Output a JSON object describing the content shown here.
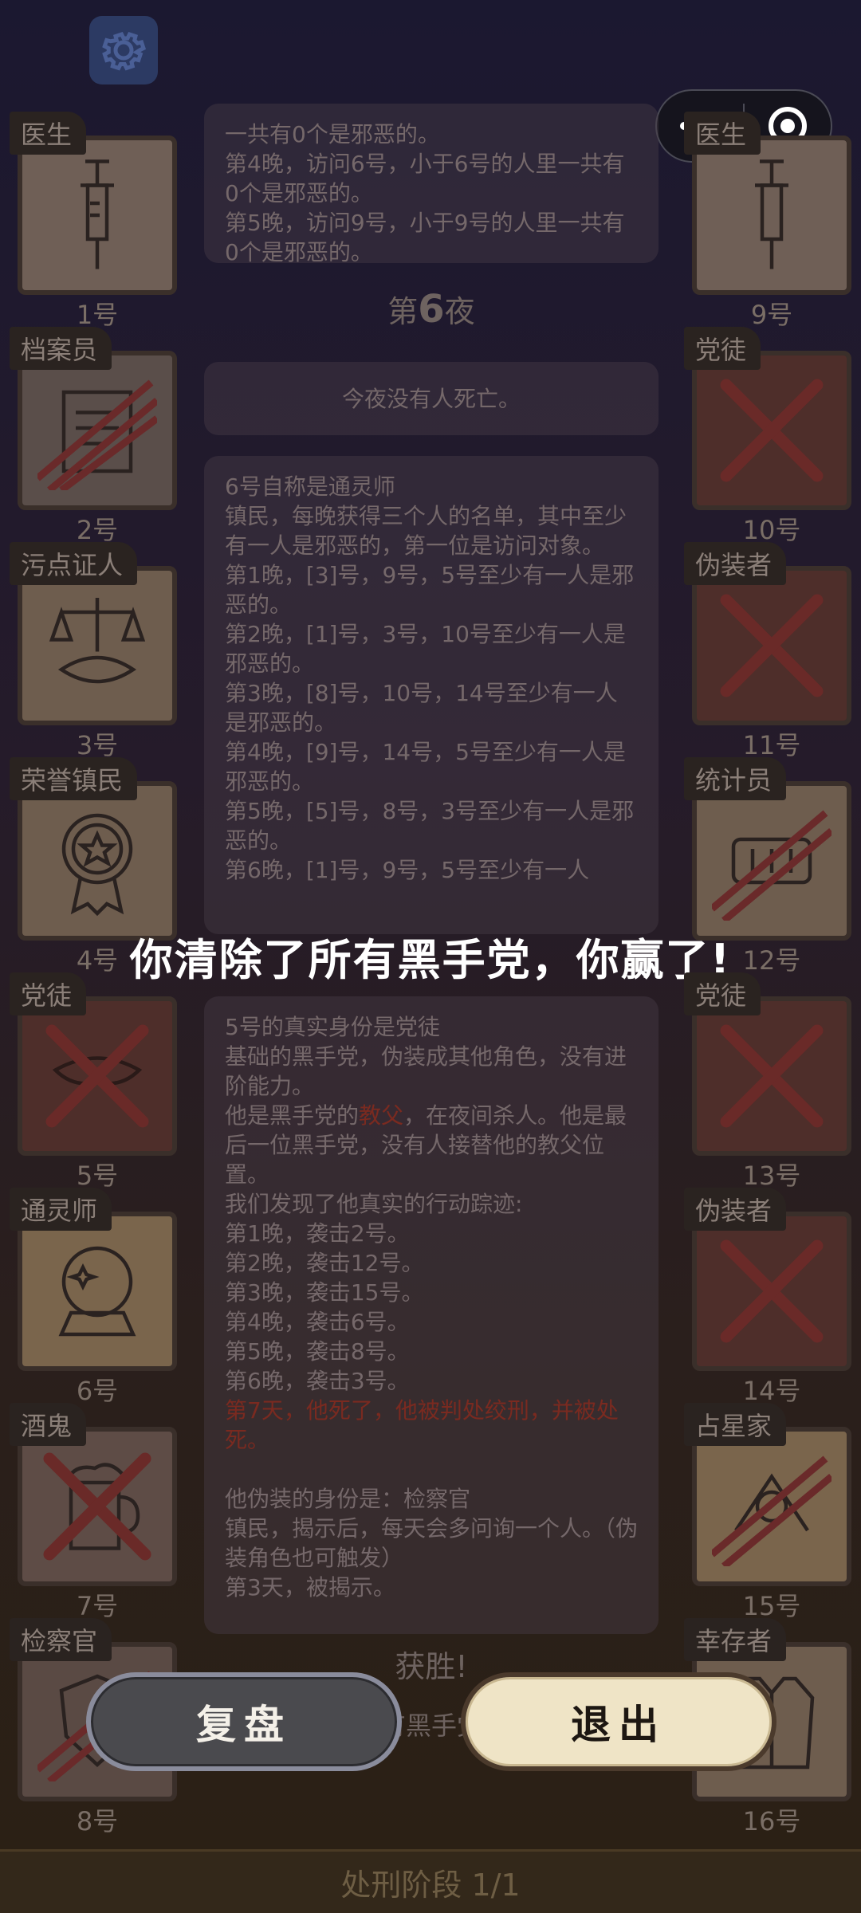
{
  "capsule": {
    "more_icon": "more-dots-icon",
    "close_icon": "target-close-icon"
  },
  "left_cards": [
    {
      "role": "医生",
      "num": "1号",
      "icon": "syringe-icon",
      "status": "alive"
    },
    {
      "role": "档案员",
      "num": "2号",
      "icon": "document-icon",
      "status": "slashed"
    },
    {
      "role": "污点证人",
      "num": "3号",
      "icon": "scales-icon",
      "status": "alive"
    },
    {
      "role": "荣誉镇民",
      "num": "4号",
      "icon": "medal-icon",
      "status": "alive"
    },
    {
      "role": "党徒",
      "num": "5号",
      "icon": "mask-icon",
      "status": "crossed"
    },
    {
      "role": "通灵师",
      "num": "6号",
      "icon": "crystal-ball-icon",
      "status": "alive"
    },
    {
      "role": "酒鬼",
      "num": "7号",
      "icon": "beer-icon",
      "status": "crossed"
    },
    {
      "role": "检察官",
      "num": "8号",
      "icon": "badge-icon",
      "status": "slashed"
    }
  ],
  "right_cards": [
    {
      "role": "医生",
      "num": "9号",
      "icon": "syringe-icon",
      "status": "alive"
    },
    {
      "role": "党徒",
      "num": "10号",
      "icon": "mask-icon",
      "status": "crossed"
    },
    {
      "role": "伪装者",
      "num": "11号",
      "icon": "mask-icon",
      "status": "crossed"
    },
    {
      "role": "统计员",
      "num": "12号",
      "icon": "counter-icon",
      "status": "slashed"
    },
    {
      "role": "党徒",
      "num": "13号",
      "icon": "mask-icon",
      "status": "crossed"
    },
    {
      "role": "伪装者",
      "num": "14号",
      "icon": "mask-icon",
      "status": "crossed"
    },
    {
      "role": "占星家",
      "num": "15号",
      "icon": "astrolabe-icon",
      "status": "slashed"
    },
    {
      "role": "幸存者",
      "num": "16号",
      "icon": "vest-icon",
      "status": "alive"
    }
  ],
  "log": {
    "top_panel": [
      "一共有0个是邪恶的。",
      "第4晚，访问6号，小于6号的人里一共有0个是邪恶的。",
      "第5晚，访问9号，小于9号的人里一共有0个是邪恶的。"
    ],
    "night_title_prefix": "第",
    "night_title_num": "6",
    "night_title_suffix": "夜",
    "no_death": "今夜没有人死亡。",
    "medium_panel": [
      "6号自称是通灵师",
      "镇民，每晚获得三个人的名单，其中至少有一人是邪恶的，第一位是访问对象。",
      "第1晚，[3]号，9号，5号至少有一人是邪恶的。",
      "第2晚，[1]号，3号，10号至少有一人是邪恶的。",
      "第3晚，[8]号，10号，14号至少有一人是邪恶的。",
      "第4晚，[9]号，14号，5号至少有一人是邪恶的。",
      "第5晚，[5]号，8号，3号至少有一人是邪恶的。",
      "第6晚，[1]号，9号，5号至少有一人"
    ],
    "reveal_panel": {
      "l1": "5号的真实身份是党徒",
      "l2": "基础的黑手党，伪装成其他角色，没有进阶能力。",
      "l3a": "他是黑手党的",
      "l3b": "教父",
      "l3c": "，在夜间杀人。他是最后一位黑手党，没有人接替他的教父位置。",
      "l4": "我们发现了他真实的行动踪迹:",
      "kills": [
        "第1晚，袭击2号。",
        "第2晚，袭击12号。",
        "第3晚，袭击15号。",
        "第4晚，袭击6号。",
        "第5晚，袭击8号。",
        "第6晚，袭击3号。"
      ],
      "red_line": "第7天，他死了，他被判处绞刑，并被处死。",
      "disguise": "他伪装的身份是：检察官",
      "disguise_desc": "镇民，揭示后，每天会多问询一个人。（伪装角色也可触发）",
      "revealed": "第3天，被揭示。"
    },
    "victory": "获胜!",
    "victory_sub": "有黑手党"
  },
  "overlay": {
    "message": "你清除了所有黑手党，你赢了!",
    "review_label": "复盘",
    "exit_label": "退出"
  },
  "footer": {
    "phase": "处刑阶段 1/1"
  }
}
